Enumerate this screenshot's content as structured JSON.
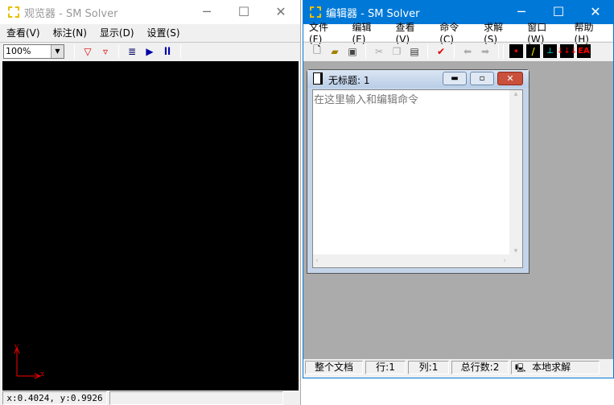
{
  "viewer": {
    "title": "观览器 - SM Solver",
    "menu": [
      "查看(V)",
      "标注(N)",
      "显示(D)",
      "设置(S)"
    ],
    "zoom_value": "100%",
    "status_coords": "x:0.4024, y:0.9926",
    "axis_x": "x",
    "axis_y": "y"
  },
  "editor": {
    "title": "编辑器 - SM Solver",
    "menu": [
      "文件(F)",
      "编辑(E)",
      "查看(V)",
      "命令(C)",
      "求解(S)",
      "窗口(W)",
      "帮助(H)"
    ],
    "doc": {
      "title": "无标题: 1",
      "placeholder": "在这里输入和编辑命令"
    },
    "status": [
      "整个文档",
      "行:1",
      "列:1",
      "总行数:2",
      "本地求解"
    ],
    "accent": "#0078d7"
  }
}
